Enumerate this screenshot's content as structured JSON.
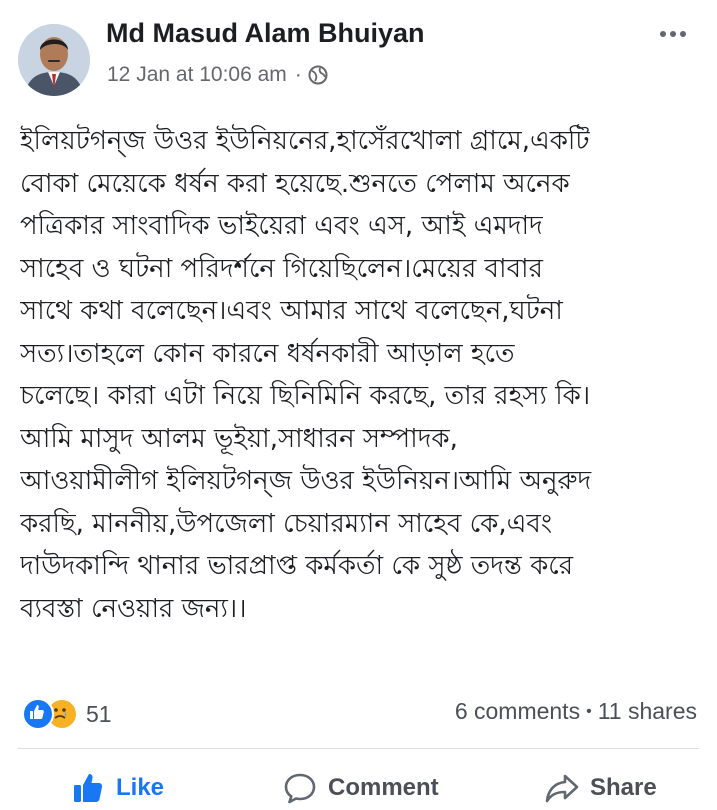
{
  "post": {
    "author": "Md Masud Alam Bhuiyan",
    "timestamp": "12 Jan at 10:06 am",
    "meta_separator": "·",
    "privacy_icon": "globe-icon",
    "more_icon": "more-options-icon",
    "body_lines": [
      "ইলিয়টগন্জ উওর ইউনিয়নের,হাসেঁরখোলা গ্রামে,একটি",
      "বোকা মেয়েকে ধর্ষন করা হয়েছে.শুনতে পেলাম অনেক",
      "পত্রিকার সাংবাদিক ভাইয়েরা এবং এস, আই এমদাদ",
      "সাহেব ও ঘটনা পরিদর্শনে গিয়েছিলেন।মেয়ের বাবার",
      "সাথে কথা বলেছেন।এবং আমার সাথে বলেছেন,ঘটনা",
      "সত্য।তাহলে কোন কারনে ধর্ষনকারী আড়াল হতে",
      "চলেছে। কারা এটা নিয়ে ছিনিমিনি করছে, তার রহস্য কি।",
      "আমি মাসুদ আলম ভূইয়া,সাধারন সম্পাদক,",
      "আওয়ামীলীগ ইলিয়টগন্জ উওর ইউনিয়ন।আমি অনুরুদ",
      "করছি, মাননীয়,উপজেলা চেয়ারম্যান সাহেব কে,এবং",
      "দাউদকান্দি থানার  ভারপ্রাপ্ত কর্মকর্তা কে সুষ্ঠ তদন্ত করে",
      "ব্যবস্তা নেওয়ার জন্য।।"
    ]
  },
  "stats": {
    "reaction_icons": [
      "like-reaction-icon",
      "sad-reaction-icon"
    ],
    "reaction_count": "51",
    "comments": "6 comments",
    "separator": "•",
    "shares": "11 shares"
  },
  "actions": {
    "like_label": "Like",
    "comment_label": "Comment",
    "share_label": "Share"
  },
  "colors": {
    "accent": "#1877f2",
    "text": "#1c1e21",
    "secondary_text": "#65676b",
    "sad_reaction": "#f7b125"
  }
}
